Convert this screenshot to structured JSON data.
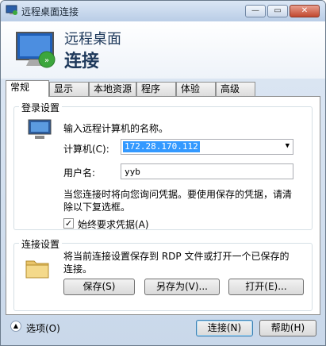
{
  "window": {
    "title": "远程桌面连接"
  },
  "header": {
    "line1": "远程桌面",
    "line2": "连接"
  },
  "tabs": [
    "常规",
    "显示",
    "本地资源",
    "程序",
    "体验",
    "高级"
  ],
  "login": {
    "legend": "登录设置",
    "prompt": "输入远程计算机的名称。",
    "computer_label": "计算机(C):",
    "computer_value": "172.28.170.112",
    "username_label": "用户名:",
    "username_value": "yyb",
    "note": "当您连接时将向您询问凭据。要使用保存的凭据，请清除以下复选框。",
    "always_ask_label": "始终要求凭据(A)",
    "always_ask_checked": true
  },
  "conn": {
    "legend": "连接设置",
    "text": "将当前连接设置保存到 RDP 文件或打开一个已保存的连接。",
    "save": "保存(S)",
    "save_as": "另存为(V)...",
    "open": "打开(E)..."
  },
  "footer": {
    "options": "选项(O)",
    "connect": "连接(N)",
    "help": "帮助(H)"
  },
  "controls": {
    "min": "—",
    "max": "▭",
    "close": "✕"
  }
}
